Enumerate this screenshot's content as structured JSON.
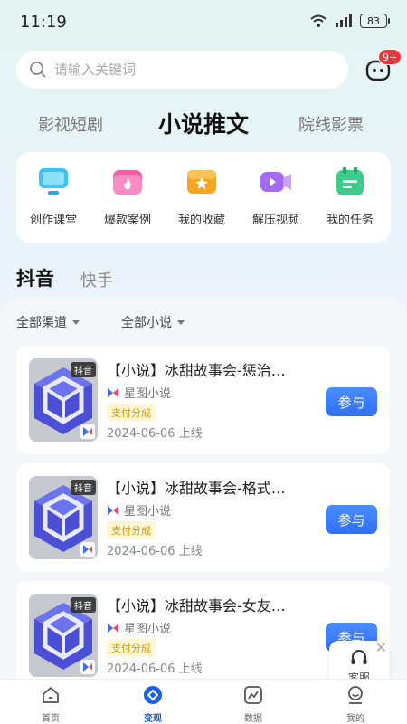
{
  "status": {
    "time": "11:19",
    "battery": "83"
  },
  "search": {
    "placeholder": "请输入关键词"
  },
  "messages": {
    "badge": "9+"
  },
  "top_tabs": [
    {
      "label": "影视短剧",
      "active": false
    },
    {
      "label": "小说推文",
      "active": true
    },
    {
      "label": "院线影票",
      "active": false
    }
  ],
  "quick_links": [
    {
      "label": "创作课堂",
      "icon": "monitor-icon",
      "color": "#3fc2ef"
    },
    {
      "label": "爆款案例",
      "icon": "folder-fire-icon",
      "color": "#f25fa5"
    },
    {
      "label": "我的收藏",
      "icon": "star-folder-icon",
      "color": "#f4a622"
    },
    {
      "label": "解压视频",
      "icon": "video-camera-icon",
      "color": "#a56af0"
    },
    {
      "label": "我的任务",
      "icon": "calendar-task-icon",
      "color": "#3dcc8a"
    }
  ],
  "platform_tabs": [
    {
      "label": "抖音",
      "active": true
    },
    {
      "label": "快手",
      "active": false
    }
  ],
  "filters": [
    {
      "label": "全部渠道"
    },
    {
      "label": "全部小说"
    }
  ],
  "cards": [
    {
      "title": "【小说】冰甜故事会-惩治…",
      "cover_tag": "抖音",
      "source": "星图小说",
      "badge": "支付分成",
      "date": "2024-06-06 上线",
      "button": "参与"
    },
    {
      "title": "【小说】冰甜故事会-格式…",
      "cover_tag": "抖音",
      "source": "星图小说",
      "badge": "支付分成",
      "date": "2024-06-06 上线",
      "button": "参与"
    },
    {
      "title": "【小说】冰甜故事会-女友…",
      "cover_tag": "抖音",
      "source": "星图小说",
      "badge": "支付分成",
      "date": "2024-06-06 上线",
      "button": "参与"
    }
  ],
  "customer_service": {
    "label": "客服",
    "close": "✕"
  },
  "bottom_nav": [
    {
      "label": "首页",
      "icon": "home-icon",
      "active": false
    },
    {
      "label": "变现",
      "icon": "monetize-icon",
      "active": true
    },
    {
      "label": "数据",
      "icon": "chart-icon",
      "active": false
    },
    {
      "label": "我的",
      "icon": "profile-icon",
      "active": false
    }
  ],
  "colors": {
    "accent": "#2f6ff5",
    "badge_red": "#f0343a",
    "nav_active": "#1c5fe0"
  }
}
